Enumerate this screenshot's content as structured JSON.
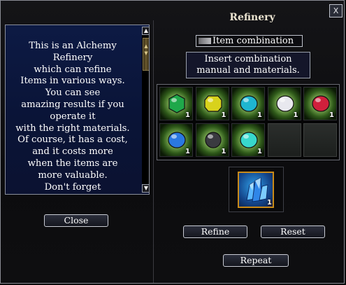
{
  "window": {
    "title": "Refinery",
    "close_glyph": "X"
  },
  "description": {
    "text": "This is an Alchemy\nRefinery\nwhich can refine\nItems in various ways.\nYou can see\namazing results if you\noperate it\nwith the right materials.\nOf course, it has a cost,\nand it costs more\nwhen the items are\nmore valuable.\nDon't forget",
    "scroll_up_glyph": "▲",
    "scroll_down_glyph": "▼"
  },
  "buttons": {
    "close": "Close",
    "refine": "Refine",
    "reset": "Reset",
    "repeat": "Repeat"
  },
  "combination": {
    "mode_label": "Item combination",
    "instruction": "Insert combination\nmanual and materials."
  },
  "material_slots": [
    {
      "icon": "green-emerald-icon",
      "color": "#1fa84a",
      "qty": "1"
    },
    {
      "icon": "yellow-topaz-icon",
      "color": "#d8d21c",
      "qty": "1"
    },
    {
      "icon": "cyan-aquamarine-icon",
      "color": "#1fb6d0",
      "qty": "1"
    },
    {
      "icon": "white-diamond-icon",
      "color": "#e8e8ee",
      "qty": "1"
    },
    {
      "icon": "red-ruby-icon",
      "color": "#d0203c",
      "qty": "1"
    },
    {
      "icon": "blue-sapphire-icon",
      "color": "#2a78e0",
      "qty": "1"
    },
    {
      "icon": "black-pearl-icon",
      "color": "#3a3a40",
      "qty": "1"
    },
    {
      "icon": "teal-crystal-icon",
      "color": "#38d8cc",
      "qty": "1"
    },
    {
      "icon": null,
      "color": null,
      "qty": null
    },
    {
      "icon": null,
      "color": null,
      "qty": null
    }
  ],
  "result": {
    "icon": "blue-crystal-cluster-icon",
    "color": "#3a9ef0",
    "qty": "1"
  }
}
